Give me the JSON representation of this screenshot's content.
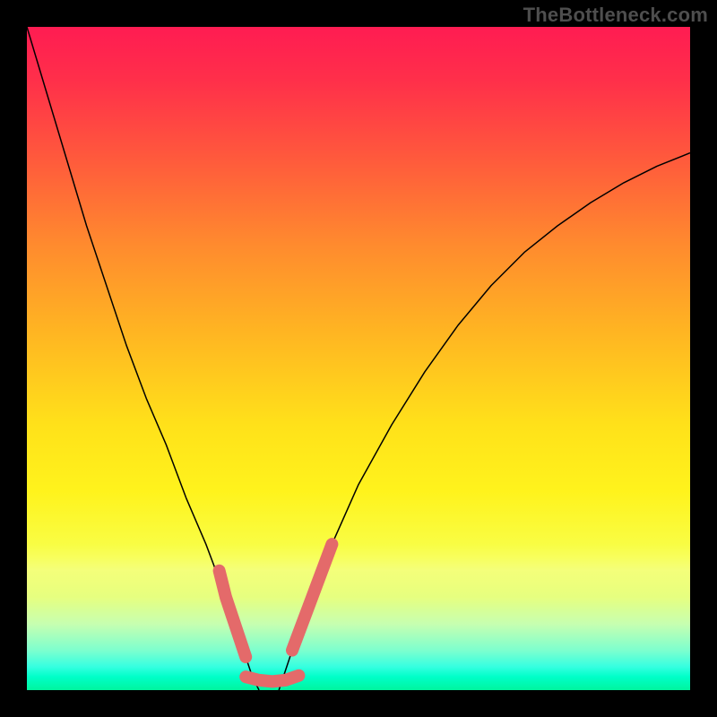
{
  "watermark": {
    "text": "TheBottleneck.com"
  },
  "chart_data": {
    "type": "line",
    "title": "",
    "xlabel": "",
    "ylabel": "",
    "xlim": [
      0,
      100
    ],
    "ylim": [
      0,
      100
    ],
    "grid": false,
    "legend": false,
    "background": {
      "gradient_stops": [
        {
          "pos": 0,
          "color": "#ff1c52"
        },
        {
          "pos": 20,
          "color": "#ff5a3c"
        },
        {
          "pos": 46,
          "color": "#ffb522"
        },
        {
          "pos": 70,
          "color": "#fff31c"
        },
        {
          "pos": 90,
          "color": "#c7ffb0"
        },
        {
          "pos": 100,
          "color": "#00f59e"
        }
      ]
    },
    "series": [
      {
        "name": "bottleneck-curve-left",
        "color": "#000000",
        "stroke_width": 1.5,
        "x": [
          0,
          3,
          6,
          9,
          12,
          15,
          18,
          21,
          24,
          27,
          30,
          31,
          32,
          33,
          34,
          35
        ],
        "y": [
          100,
          90,
          80,
          70,
          61,
          52,
          44,
          37,
          29,
          22,
          14,
          11,
          8,
          5,
          2,
          0
        ]
      },
      {
        "name": "bottleneck-curve-right",
        "color": "#000000",
        "stroke_width": 1.5,
        "x": [
          38,
          40,
          43,
          46,
          50,
          55,
          60,
          65,
          70,
          75,
          80,
          85,
          90,
          95,
          100
        ],
        "y": [
          0,
          6,
          14,
          22,
          31,
          40,
          48,
          55,
          61,
          66,
          70,
          73.5,
          76.5,
          79,
          81
        ]
      },
      {
        "name": "highlight-left",
        "color": "#e46a6a",
        "stroke_width": 14,
        "linecap": "round",
        "x": [
          29,
          30,
          31,
          32,
          33
        ],
        "y": [
          18,
          14,
          11,
          8,
          5
        ]
      },
      {
        "name": "highlight-bottom",
        "color": "#e46a6a",
        "stroke_width": 14,
        "linecap": "round",
        "x": [
          33,
          35,
          37,
          39,
          41
        ],
        "y": [
          2,
          1.5,
          1.3,
          1.5,
          2.2
        ]
      },
      {
        "name": "highlight-right",
        "color": "#e46a6a",
        "stroke_width": 14,
        "linecap": "round",
        "x": [
          40,
          41.5,
          43,
          44.5,
          46
        ],
        "y": [
          6,
          10,
          14,
          18,
          22
        ]
      }
    ]
  }
}
